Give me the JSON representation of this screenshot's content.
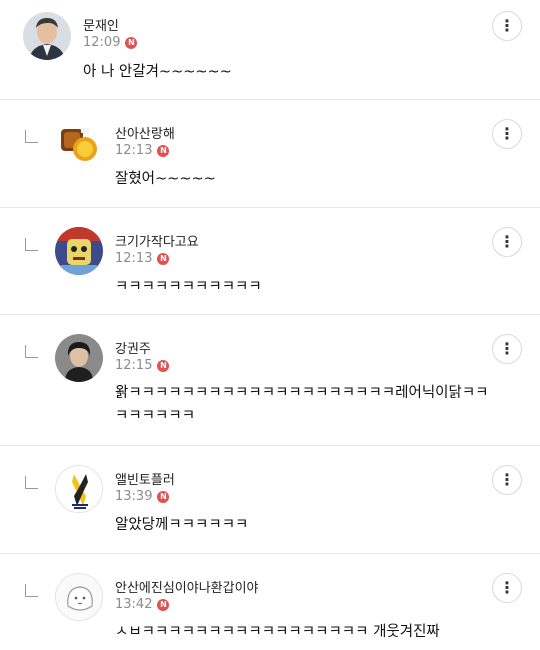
{
  "comments": [
    {
      "author": "문재인",
      "time": "12:09",
      "badge": "N",
      "text": "아 나 안갈겨~~~~~~",
      "more": "⋮"
    },
    {
      "author": "산아산랑해",
      "time": "12:13",
      "badge": "N",
      "text": "잘혔어~~~~~",
      "more": "⋮"
    },
    {
      "author": "크기가작다고요",
      "time": "12:13",
      "badge": "N",
      "text": "ㅋㅋㅋㅋㅋㅋㅋㅋㅋㅋㅋ",
      "more": "⋮"
    },
    {
      "author": "강권주",
      "time": "12:15",
      "badge": "N",
      "text": "왉ㅋㅋㅋㅋㅋㅋㅋㅋㅋㅋㅋㅋㅋㅋㅋㅋㅋㅋㅋㅋ레어닉이닭ㅋㅋㅋㅋㅋㅋㅋㅋ",
      "more": "⋮"
    },
    {
      "author": "앨빈토플러",
      "time": "13:39",
      "badge": "N",
      "text": "알았당께ㅋㅋㅋㅋㅋㅋ",
      "more": "⋮"
    },
    {
      "author": "안산에진심이야나환갑이야",
      "time": "13:42",
      "badge": "N",
      "text": "ㅅㅂㅋㅋㅋㅋㅋㅋㅋㅋㅋㅋㅋㅋㅋㅋㅋㅋㅋ 개웃겨진짜",
      "more": "⋮"
    }
  ]
}
